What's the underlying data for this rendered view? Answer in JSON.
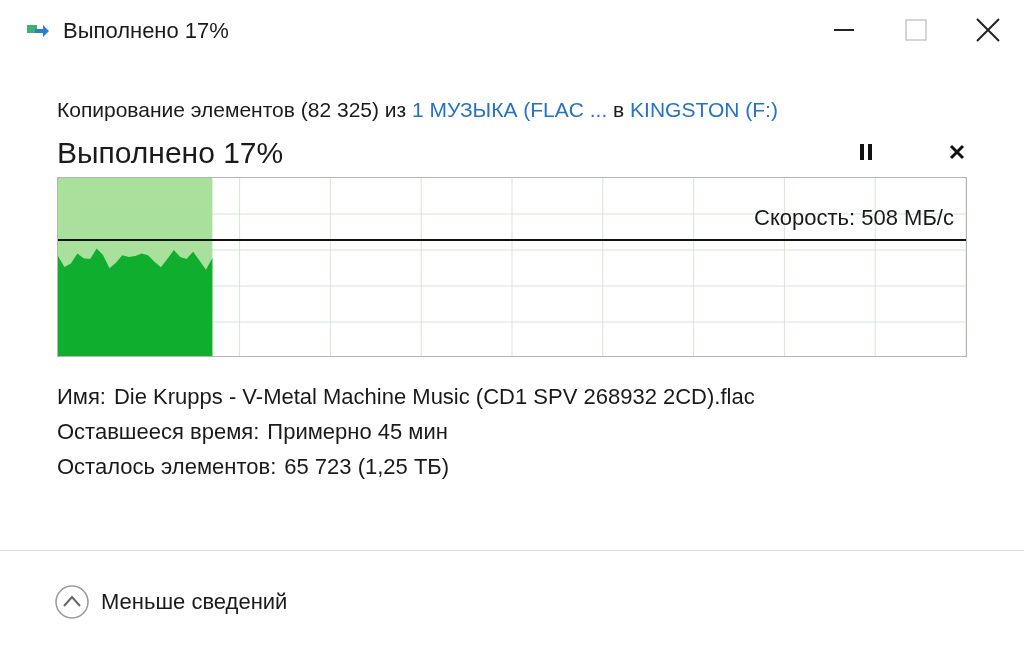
{
  "window": {
    "title": "Выполнено 17%",
    "controls": [
      {
        "kind": "minimize",
        "disabled": false
      },
      {
        "kind": "maximize",
        "disabled": true
      },
      {
        "kind": "close",
        "disabled": false
      }
    ]
  },
  "summary": {
    "prefix": "Копирование элементов (82 325) из ",
    "source": "1 МУЗЫКА (FLAC ...",
    "middle": " в ",
    "destination": "KINGSTON (F:)"
  },
  "progress": {
    "heading": "Выполнено 17%",
    "level": 0.17,
    "speed": "Скорость: 508 МБ/с"
  },
  "details": [
    {
      "label": "Имя:",
      "value": "Die Krupps - V-Metal Machine Music (CD1 SPV 268932 2CD).flac"
    },
    {
      "label": "Оставшееся время:",
      "value": "Примерно 45 мин"
    },
    {
      "label": "Осталось элементов:",
      "value": "65 723 (1,25 ТБ)"
    }
  ],
  "footer": {
    "toggle": "Меньше сведений",
    "expanded": true
  }
}
